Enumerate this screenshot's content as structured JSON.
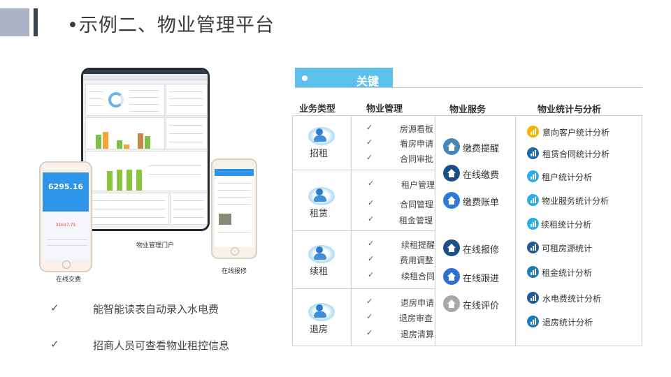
{
  "slide": {
    "title": "•示例二、物业管理平台"
  },
  "mockups": {
    "portal_caption": "物业管理门户",
    "repair_caption": "在线报修",
    "payment_caption": "在线交费",
    "payment_amount": "6295.16",
    "payment_sub_amount": "31617.75"
  },
  "bullets": [
    "能智能读表自动录入水电费",
    "招商人员可查看物业租控信息"
  ],
  "key_table": {
    "tab_label": "关键",
    "headers": [
      "业务类型",
      "物业管理",
      "物业服务",
      "物业统计与分析"
    ],
    "business_types": [
      {
        "label": "招租",
        "items": [
          "房源看板",
          "看房申请",
          "合同审批"
        ]
      },
      {
        "label": "租赁",
        "items": [
          "租户管理",
          "合同管理",
          "租金管理"
        ]
      },
      {
        "label": "续租",
        "items": [
          "续租提醒",
          "费用调整",
          "续租合同"
        ]
      },
      {
        "label": "退房",
        "items": [
          "退房申请",
          "退房审查",
          "退房清算"
        ]
      }
    ],
    "services": [
      {
        "label": "缴费提醒",
        "icon": "home-icon",
        "color": "#4a86b4"
      },
      {
        "label": "在线缴费",
        "icon": "home-icon",
        "color": "#1c4f86"
      },
      {
        "label": "缴费账单",
        "icon": "home-icon",
        "color": "#2f7ad9"
      },
      {
        "label": "在线报修",
        "icon": "home-icon",
        "color": "#1c4f86"
      },
      {
        "label": "在线跟进",
        "icon": "home-icon",
        "color": "#2f6fd0"
      },
      {
        "label": "在线评价",
        "icon": "home-icon",
        "color": "#a8a8a8"
      }
    ],
    "statistics": [
      {
        "label": "意向客户统计分析",
        "color": "#f4b400"
      },
      {
        "label": "租赁合同统计分析",
        "color": "#1e6aa8"
      },
      {
        "label": "租户统计分析",
        "color": "#29aee8"
      },
      {
        "label": "物业服务统计分析",
        "color": "#29aee8"
      },
      {
        "label": "续租统计分析",
        "color": "#29aee8"
      },
      {
        "label": "可租房源统计",
        "color": "#1e5a96"
      },
      {
        "label": "租金统计分析",
        "color": "#1e7bb8"
      },
      {
        "label": "水电费统计分析",
        "color": "#1e5a96"
      },
      {
        "label": "退房统计分析",
        "color": "#1e7bb8"
      }
    ]
  }
}
